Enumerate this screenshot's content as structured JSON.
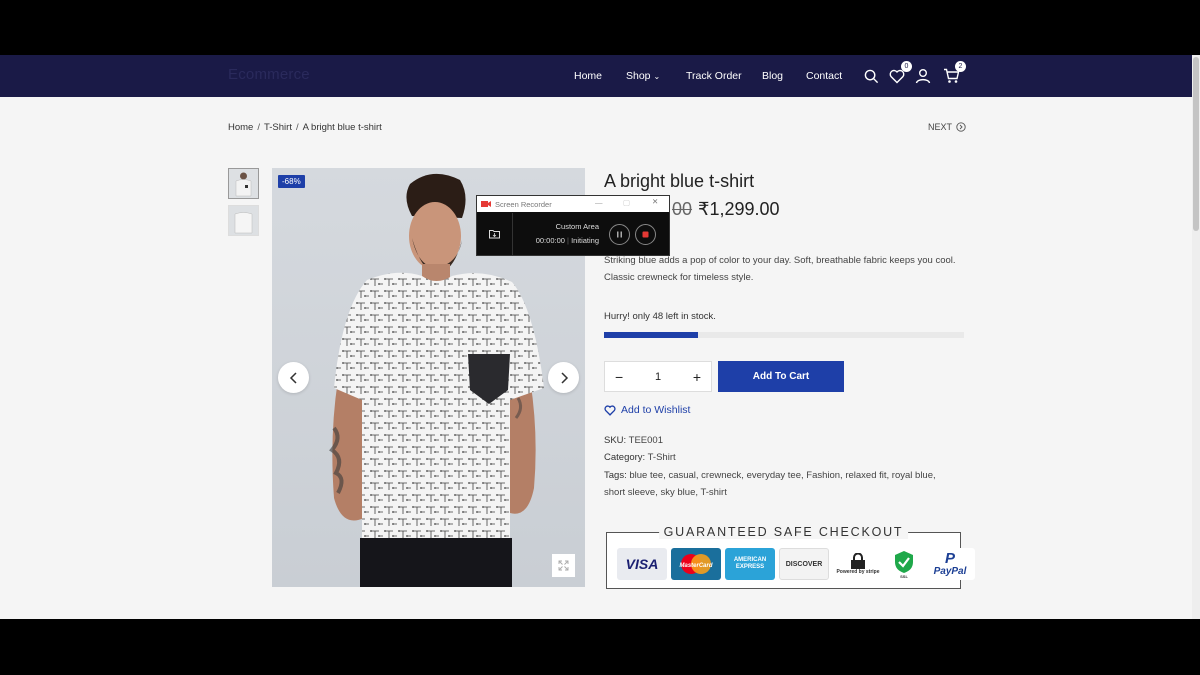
{
  "nav": {
    "logo": "Ecommerce",
    "links": [
      "Home",
      "Shop",
      "Track Order",
      "Blog",
      "Contact"
    ],
    "wishlist_count": "0",
    "cart_count": "2",
    "bg_color": "#1a1a47"
  },
  "breadcrumb": [
    "Home",
    "T-Shirt",
    "A bright blue t-shirt"
  ],
  "next_label": "NEXT",
  "gallery": {
    "sale_badge": "-68%"
  },
  "product": {
    "title": "A bright blue t-shirt",
    "old_price_visible": "00",
    "price": "₹1,299.00",
    "description": "Striking blue adds a pop of color to your day. Soft, breathable fabric keeps you cool. Classic crewneck for timeless style.",
    "stock_text": "Hurry! only 48 left in stock.",
    "stock_level": 0.26,
    "quantity": "1",
    "add_to_cart": "Add To Cart",
    "wishlist": "Add to Wishlist",
    "sku_label": "SKU:",
    "sku": "TEE001",
    "category_label": "Category:",
    "category": "T-Shirt",
    "tags_label": "Tags:",
    "tags_line1": "blue tee, casual, crewneck, everyday tee, Fashion, relaxed fit, royal blue,",
    "tags_line2": "short sleeve, sky blue, T-shirt",
    "accent_color": "#1e3fa8"
  },
  "checkout": {
    "title": "GUARANTEED SAFE CHECKOUT",
    "cards": [
      "VISA",
      "MasterCard",
      "AMERICAN EXPRESS",
      "DISCOVER",
      "Powered by stripe",
      "SSL",
      "PayPal"
    ]
  },
  "recorder": {
    "title": "Screen Recorder",
    "mode": "Custom Area",
    "time": "00:00:00",
    "status": "Initiating"
  }
}
